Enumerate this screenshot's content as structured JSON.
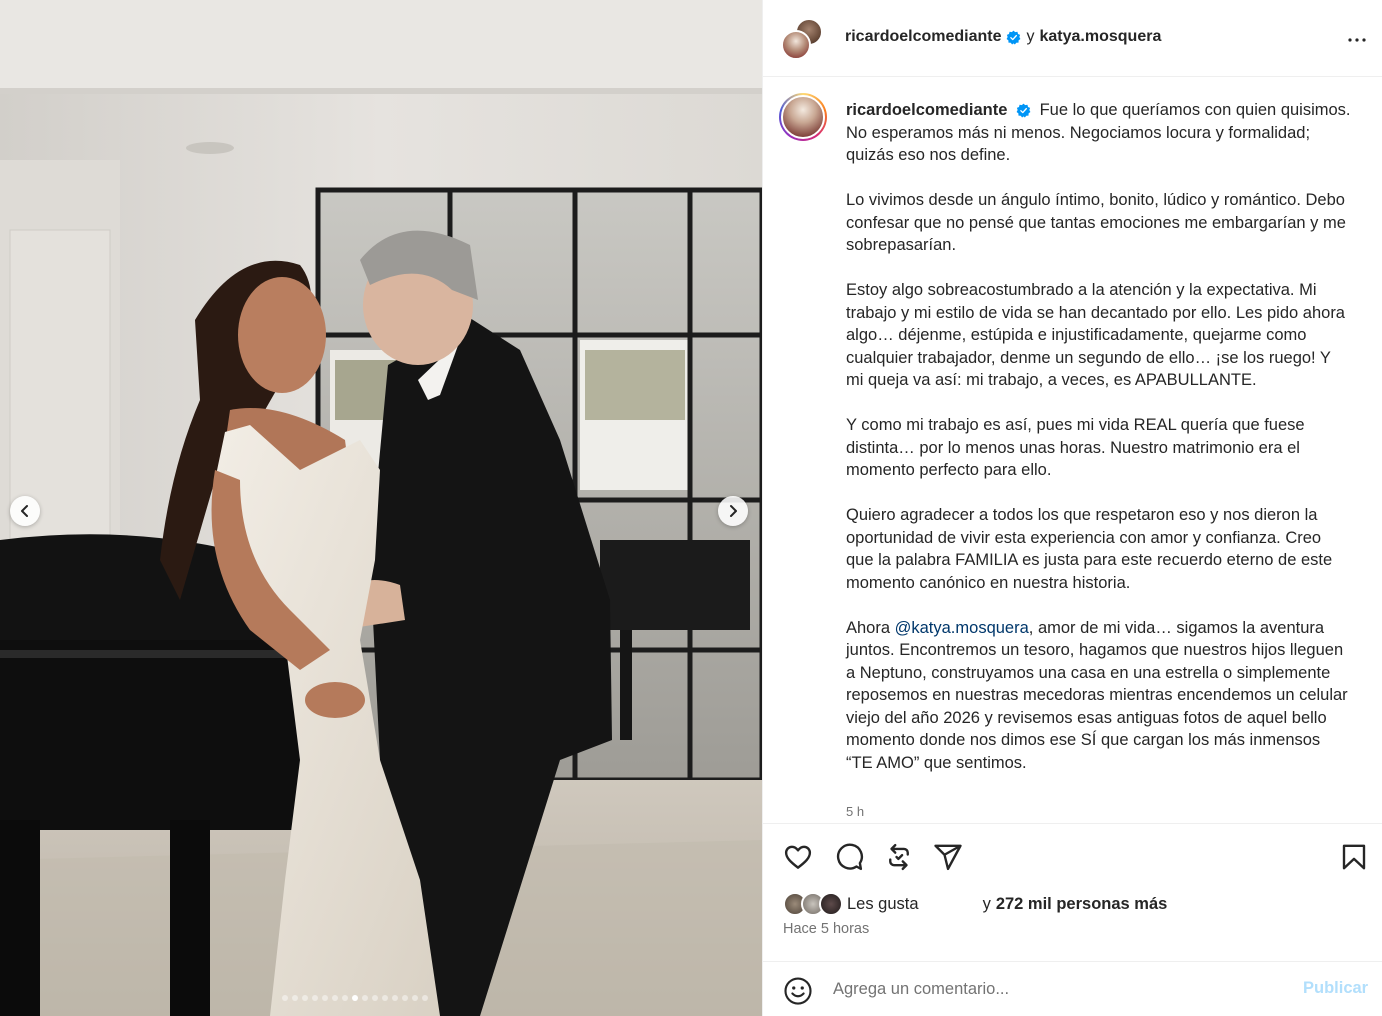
{
  "header": {
    "username_1": "ricardoelcomediante",
    "connector": "y",
    "username_2": "katya.mosquera"
  },
  "caption": {
    "username": "ricardoelcomediante",
    "paragraphs": [
      [
        "Fue lo que queríamos con quien quisimos.",
        "No esperamos más ni menos. Negociamos locura y formalidad; quizás eso nos define."
      ],
      [
        "Lo vivimos desde un ángulo íntimo, bonito, lúdico y romántico. Debo confesar que no pensé que tantas emociones me embargarían y me sobrepasarían."
      ],
      [
        "Estoy algo sobreacostumbrado a la atención y la expectativa. Mi trabajo y mi estilo de vida se han decantado por ello. Les pido ahora algo… déjenme, estúpida e injustificadamente, quejarme como cualquier trabajador, denme un segundo de ello… ¡se los ruego! Y mi queja va así: mi trabajo, a veces, es APABULLANTE."
      ],
      [
        "Y como mi trabajo es así, pues mi vida REAL quería que fuese distinta… por lo menos unas horas. Nuestro matrimonio era el momento perfecto para ello."
      ],
      [
        "Quiero agradecer a todos los que respetaron eso y nos dieron la oportunidad de vivir esta experiencia con amor y confianza. Creo que la palabra FAMILIA es justa para este recuerdo eterno de este momento canónico en nuestra historia."
      ]
    ],
    "last_prefix": "Ahora",
    "mention": "@katya.mosquera",
    "last_text": ", amor de mi vida… sigamos la aventura juntos. Encontremos un tesoro, hagamos que nuestros hijos lleguen a Neptuno, construyamos una casa en una estrella o simplemente reposemos en nuestras mecedoras mientras encendemos un celular viejo del año 2026 y revisemos esas antiguas fotos de aquel bello momento donde nos dimos ese SÍ que cargan los más inmensos “TE AMO” que sentimos.",
    "age": "5 h"
  },
  "likes": {
    "prefix": "Les gusta",
    "connector": "y",
    "count_text": "272 mil personas más"
  },
  "posted": "Hace 5 horas",
  "comment": {
    "placeholder": "Agrega un comentario...",
    "publish": "Publicar"
  },
  "carousel": {
    "total_slides": 15,
    "active_slide": 8
  },
  "colors": {
    "verified": "#0095f6",
    "mention": "#00376b",
    "publish_disabled": "#b2dffc",
    "secondary_text": "#737373"
  },
  "icons": [
    "verified-badge-icon",
    "more-options-icon",
    "heart-icon",
    "comment-icon",
    "repost-icon",
    "share-icon",
    "bookmark-icon",
    "emoji-icon",
    "chevron-left-icon",
    "chevron-right-icon"
  ]
}
